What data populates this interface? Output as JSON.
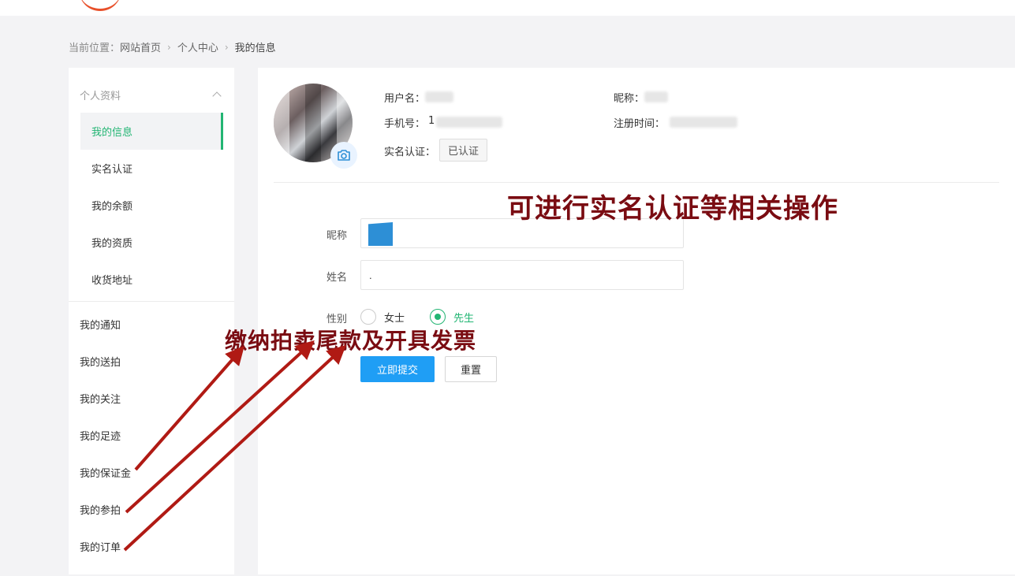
{
  "breadcrumb": {
    "prefix": "当前位置：",
    "items": [
      "网站首页",
      "个人中心",
      "我的信息"
    ],
    "sep_icon": "chevron-right-icon"
  },
  "sidebar": {
    "group_title": "个人资料",
    "group_icon": "chevron-up-icon",
    "sub_items": [
      {
        "label": "我的信息",
        "active": true
      },
      {
        "label": "实名认证"
      },
      {
        "label": "我的余额"
      },
      {
        "label": "我的资质"
      },
      {
        "label": "收货地址"
      }
    ],
    "items": [
      {
        "label": "我的通知"
      },
      {
        "label": "我的送拍"
      },
      {
        "label": "我的关注"
      },
      {
        "label": "我的足迹"
      },
      {
        "label": "我的保证金"
      },
      {
        "label": "我的参拍"
      },
      {
        "label": "我的订单"
      }
    ]
  },
  "profile": {
    "username_label": "用户名：",
    "nickname_label": "昵称：",
    "phone_label": "手机号：",
    "phone_value": "1",
    "register_label": "注册时间：",
    "realname_label": "实名认证：",
    "realname_status": "已认证",
    "camera_icon": "camera-icon"
  },
  "form": {
    "nickname_label": "昵称",
    "name_label": "姓名",
    "name_value": ".",
    "gender_label": "性别",
    "gender_options": [
      {
        "label": "女士",
        "checked": false
      },
      {
        "label": "先生",
        "checked": true
      }
    ],
    "submit_label": "立即提交",
    "reset_label": "重置"
  },
  "annotations": {
    "top": "可进行实名认证等相关操作",
    "bottom": "缴纳拍卖尾款及开具发票",
    "color": "#7a0c12",
    "arrow_color": "#b01a14"
  },
  "colors": {
    "accent_green": "#22b573",
    "primary_blue": "#1f9ef5",
    "background": "#f3f3f5"
  }
}
